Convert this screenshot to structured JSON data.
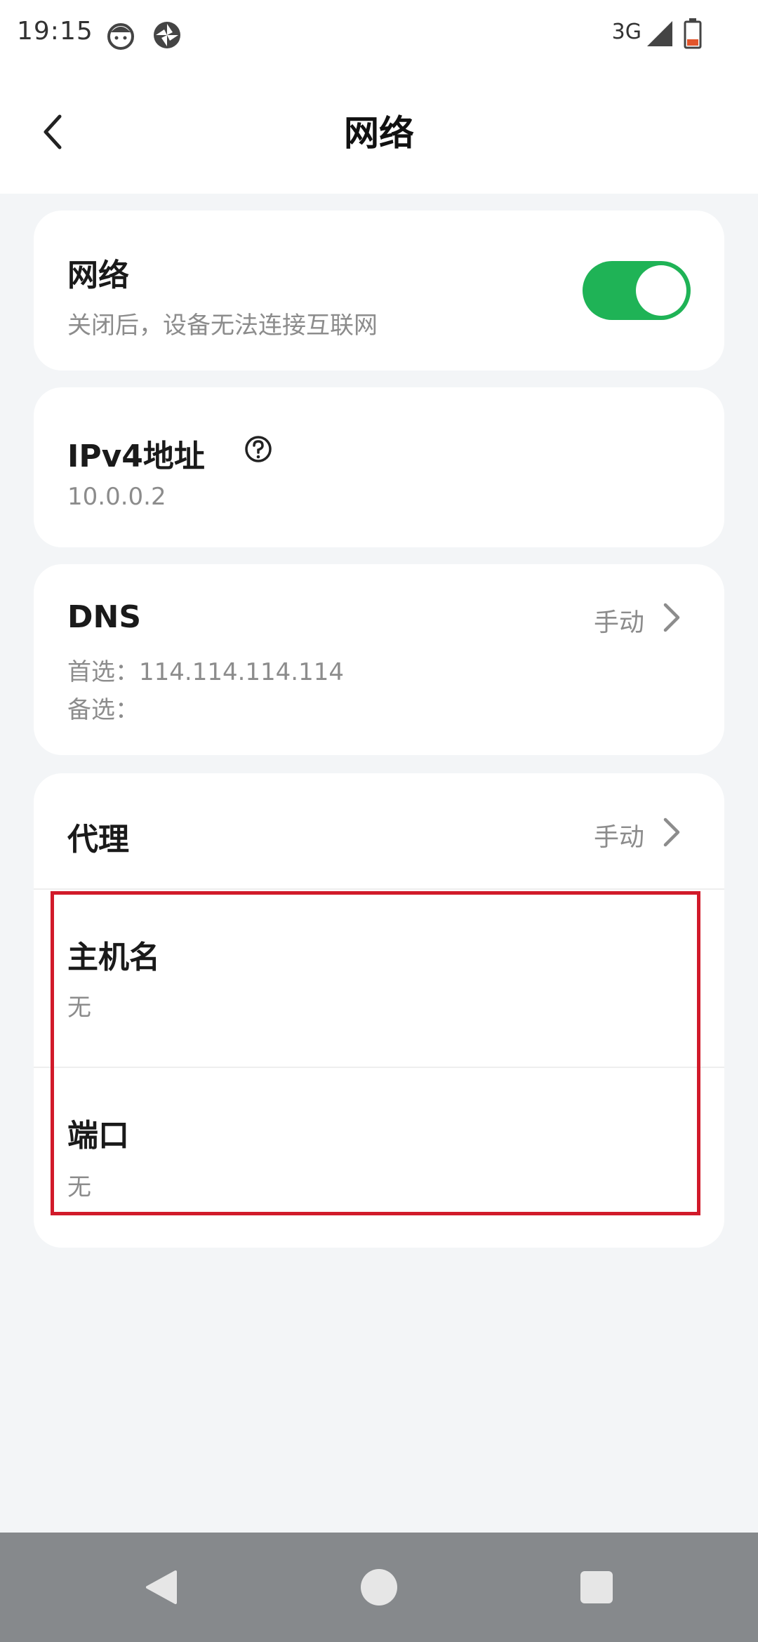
{
  "status_bar": {
    "time": "19:15",
    "network_type": "3G",
    "icons": [
      "face-notification-icon",
      "sync-icon",
      "signal-icon",
      "battery-icon"
    ]
  },
  "header": {
    "title": "网络",
    "back_icon": "chevron-left-icon"
  },
  "network_card": {
    "title": "网络",
    "subtitle": "关闭后，设备无法连接互联网",
    "toggle_on": true,
    "toggle_color": "#1fb356"
  },
  "ipv4_card": {
    "title": "IPv4地址",
    "value": "10.0.0.2",
    "help_icon": "question-circle-icon"
  },
  "dns_card": {
    "title": "DNS",
    "mode": "手动",
    "preferred": "首选：114.114.114.114",
    "alternate": "备选："
  },
  "proxy_card": {
    "title": "代理",
    "mode": "手动",
    "hostname_label": "主机名",
    "hostname_value": "无",
    "port_label": "端口",
    "port_value": "无"
  },
  "highlight_color": "#d11a2a",
  "nav_bar": {
    "buttons": [
      "back-triangle-icon",
      "home-circle-icon",
      "recents-square-icon"
    ]
  }
}
